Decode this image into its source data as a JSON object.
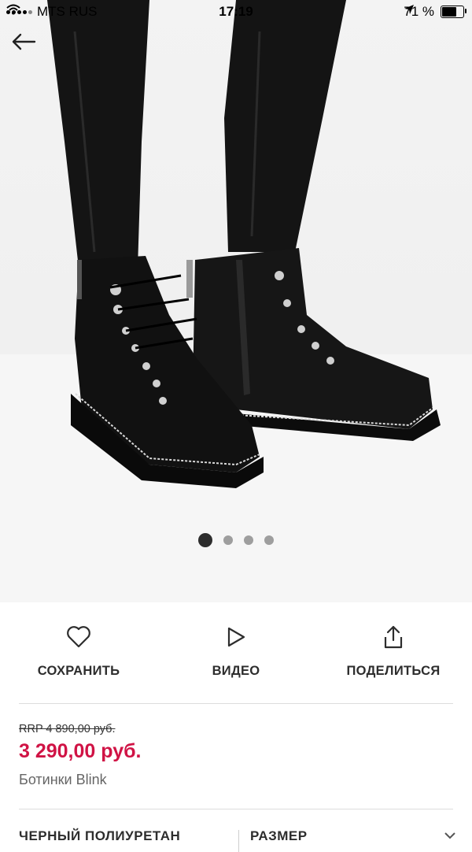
{
  "status_bar": {
    "carrier": "MTS RUS",
    "time": "17:19",
    "battery": "71 %",
    "battery_level": 0.71
  },
  "product_image": {
    "slides_total": 4,
    "active_slide": 1
  },
  "actions": {
    "save": "СОХРАНИТЬ",
    "video": "ВИДЕО",
    "share": "ПОДЕЛИТЬСЯ"
  },
  "product": {
    "rrp": "RRP 4 890,00 руб.",
    "price": "3 290,00 руб.",
    "name": "Ботинки Blink"
  },
  "options": {
    "color": "ЧЕРНЫЙ ПОЛИУРЕТАН",
    "size": "РАЗМЕР"
  },
  "colors": {
    "price": "#d01345",
    "text": "#2d2d2d"
  }
}
